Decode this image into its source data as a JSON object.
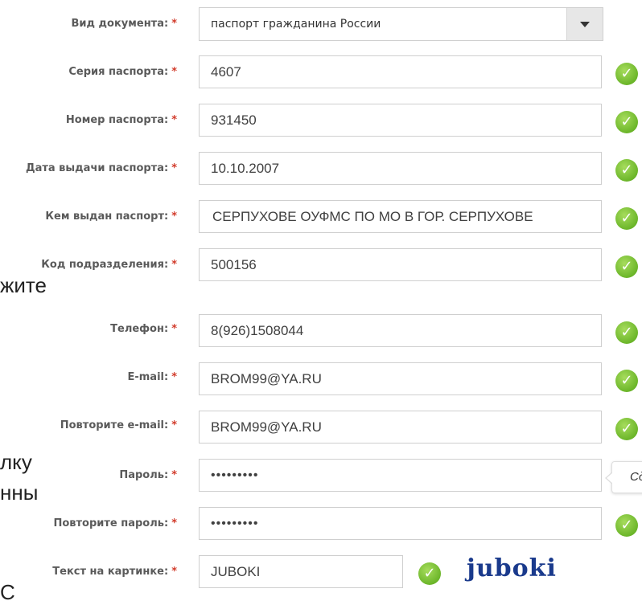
{
  "form": {
    "doc_type": {
      "label": "Вид документа:",
      "value": "паспорт гражданина России"
    },
    "series": {
      "label": "Серия паспорта:",
      "value": "4607"
    },
    "number": {
      "label": "Номер паспорта:",
      "value": "931450"
    },
    "issue_date": {
      "label": "Дата выдачи паспорта:",
      "value": "10.10.2007"
    },
    "issued_by": {
      "label": "Кем выдан паспорт:",
      "value": "СЕРПУХОВЕ ОУФМС ПО МО В ГОР. СЕРПУХОВЕ"
    },
    "dept_code": {
      "label": "Код подразделения:",
      "value": "500156"
    },
    "phone": {
      "label": "Телефон:",
      "value": "8(926)1508044"
    },
    "email": {
      "label": "E-mail:",
      "value": "BROM99@YA.RU"
    },
    "email_repeat": {
      "label": "Повторите e-mail:",
      "value": "BROM99@YA.RU"
    },
    "password": {
      "label": "Пароль:",
      "value": "•••••••••"
    },
    "password_repeat": {
      "label": "Повторите пароль:",
      "value": "•••••••••"
    },
    "captcha_text": {
      "label": "Текст на картинке:",
      "value": "JUBOKI"
    },
    "required_mark": "*"
  },
  "captcha_image": {
    "text_main": "juboki"
  },
  "tooltip": {
    "text": "Сд"
  },
  "background_text": {
    "line1": "жите",
    "line2": "лку",
    "line3": "нны",
    "line4": "С"
  },
  "colors": {
    "check": "#6cb62a",
    "required": "#d23b2b",
    "captcha": "#1a3a8c"
  },
  "icons": {
    "valid": "check-circle-icon",
    "dropdown": "chevron-down-icon"
  }
}
